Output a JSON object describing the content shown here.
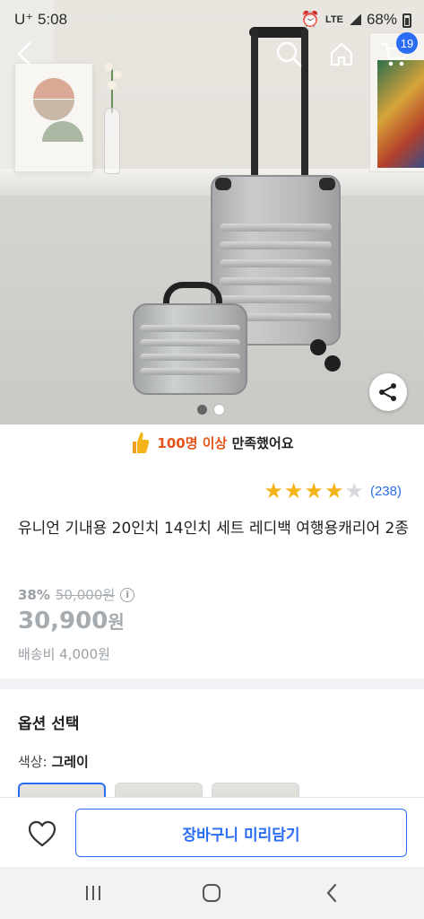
{
  "status_bar": {
    "carrier": "U⁺ 5:08",
    "network": "LTE",
    "battery": "68%"
  },
  "header": {
    "back_icon": "chevron-left-icon",
    "search_icon": "search-icon",
    "home_icon": "home-icon",
    "cart_icon": "cart-icon",
    "cart_count": "19"
  },
  "gallery": {
    "total_images": 2,
    "active_index": 0
  },
  "satisfaction": {
    "count": "100명 이상",
    "text": "만족했어요"
  },
  "rating": {
    "stars": 4,
    "max_stars": 5,
    "reviews": "(238)"
  },
  "product": {
    "title": "유니언 기내용 20인치 14인치 세트 레디백 여행용캐리어 2종",
    "discount_rate": "38%",
    "original_price": "50,000원",
    "price_number": "30,900",
    "price_unit": "원",
    "shipping": "배송비 4,000원"
  },
  "options": {
    "title": "옵션 선택",
    "color_label": "색상: ",
    "color_value": "그레이"
  },
  "actions": {
    "cart_button": "장바구니 미리담기"
  },
  "colors": {
    "accent": "#2a6df4",
    "highlight": "#e5531a",
    "star": "#f5b31a"
  }
}
